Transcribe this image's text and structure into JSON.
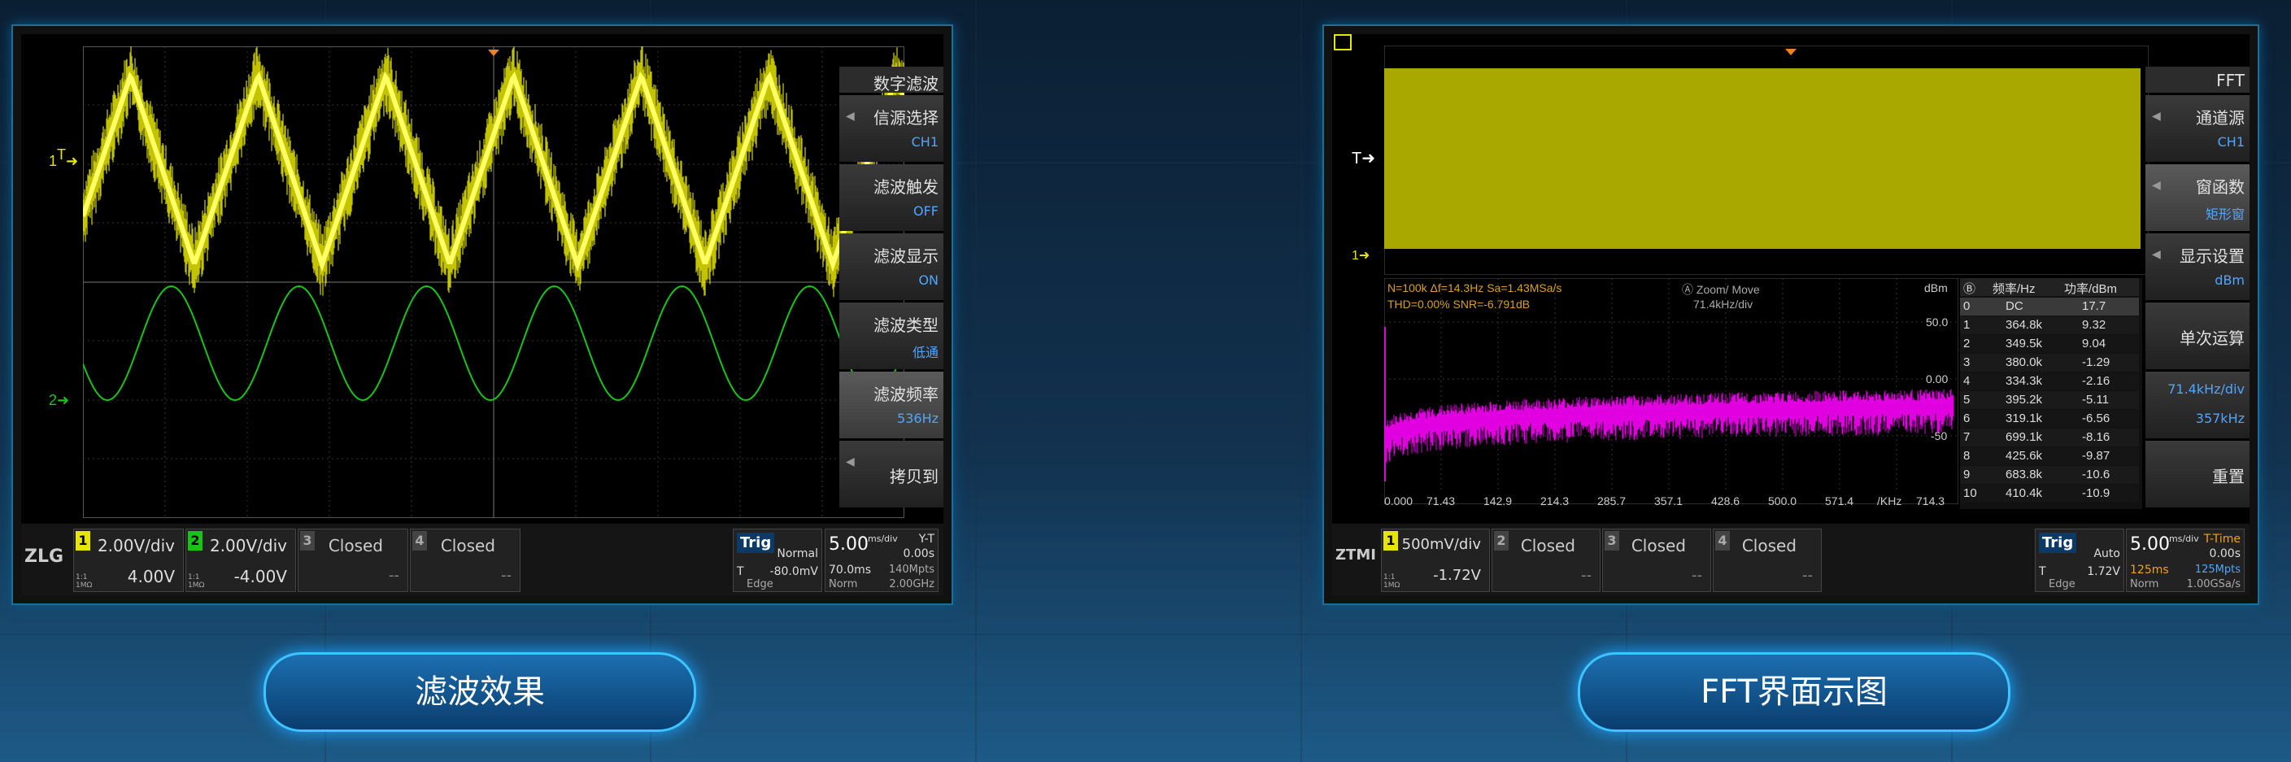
{
  "left_panel": {
    "menu": {
      "title": "数字滤波",
      "items": [
        {
          "label": "信源选择",
          "value": "CH1"
        },
        {
          "label": "滤波触发",
          "value": "OFF"
        },
        {
          "label": "滤波显示",
          "value": "ON"
        },
        {
          "label": "滤波类型",
          "value": "低通"
        },
        {
          "label": "滤波频率",
          "value": "536Hz"
        },
        {
          "label": "拷贝到",
          "value": ""
        }
      ]
    },
    "marker_1": "1",
    "marker_T": "T",
    "marker_2": "2",
    "status": {
      "logo": "ZLG",
      "ch1": {
        "num": "1",
        "scale": "2.00V/div",
        "offset": "4.00V",
        "imp": "1:1 1MΩ"
      },
      "ch2": {
        "num": "2",
        "scale": "2.00V/div",
        "offset": "-4.00V",
        "imp": "1:1 1MΩ"
      },
      "ch3": {
        "num": "3",
        "state": "Closed",
        "dash": "--"
      },
      "ch4": {
        "num": "4",
        "state": "Closed",
        "dash": "--"
      },
      "trig_label": "Trig",
      "trig_mode": "Normal",
      "trig_level": "-80.0mV",
      "trig_T": "T",
      "trig_type": "Edge",
      "time_scale": "5.00",
      "time_unit": "ms/div",
      "time_mode": "Y-T",
      "time_offset": "0.00s",
      "time_window": "70.0ms",
      "mem_depth": "140Mpts",
      "acq_mode": "Norm",
      "sample_rate": "2.00GHz"
    }
  },
  "right_panel": {
    "menu": {
      "title": "FFT",
      "items": [
        {
          "label": "通道源",
          "value": "CH1"
        },
        {
          "label": "窗函数",
          "value": "矩形窗"
        },
        {
          "label": "显示设置",
          "value": "dBm"
        },
        {
          "label": "单次运算",
          "value": ""
        },
        {
          "label": "71.4kHz/div",
          "value": "357kHz"
        },
        {
          "label": "重置",
          "value": ""
        }
      ]
    },
    "marker_T": "T",
    "marker_1": "1",
    "fft_info": {
      "line1": "N=100k  Δf=14.3Hz  Sa=1.43MSa/s",
      "line2": "THD=0.00%  SNR=-6.791dB",
      "zoom": "Zoom/ Move",
      "zoom_scale": "71.4kHz/div",
      "unit": "dBm",
      "y_ticks": [
        "50.0",
        "0.00",
        "-50"
      ],
      "x_ticks": [
        "0.000",
        "71.43",
        "142.9",
        "214.3",
        "285.7",
        "357.1",
        "428.6",
        "500.0",
        "571.4",
        "/KHz",
        "714.3"
      ]
    },
    "table": {
      "header": [
        "Ⓑ",
        "频率/Hz",
        "功率/dBm"
      ],
      "rows": [
        [
          "0",
          "DC",
          "17.7"
        ],
        [
          "1",
          "364.8k",
          "9.32"
        ],
        [
          "2",
          "349.5k",
          "9.04"
        ],
        [
          "3",
          "380.0k",
          "-1.29"
        ],
        [
          "4",
          "334.3k",
          "-2.16"
        ],
        [
          "5",
          "395.2k",
          "-5.11"
        ],
        [
          "6",
          "319.1k",
          "-6.56"
        ],
        [
          "7",
          "699.1k",
          "-8.16"
        ],
        [
          "8",
          "425.6k",
          "-9.87"
        ],
        [
          "9",
          "683.8k",
          "-10.6"
        ],
        [
          "10",
          "410.4k",
          "-10.9"
        ]
      ]
    },
    "status": {
      "logo": "ZTMI",
      "ch1": {
        "num": "1",
        "scale": "500mV/div",
        "offset": "-1.72V",
        "imp": "1:1 1MΩ"
      },
      "ch2": {
        "num": "2",
        "state": "Closed",
        "dash": "--"
      },
      "ch3": {
        "num": "3",
        "state": "Closed",
        "dash": "--"
      },
      "ch4": {
        "num": "4",
        "state": "Closed",
        "dash": "--"
      },
      "trig_label": "Trig",
      "trig_mode": "Auto",
      "trig_level": "1.72V",
      "trig_T": "T",
      "trig_type": "Edge",
      "time_scale": "5.00",
      "time_unit": "ms/div",
      "time_mode": "T-Time",
      "time_offset": "0.00s",
      "time_window": "125ms",
      "mem_depth": "125Mpts",
      "acq_mode": "Norm",
      "sample_rate": "1.00GSa/s"
    }
  },
  "buttons": {
    "left": "滤波效果",
    "right": "FFT界面示图"
  },
  "colors": {
    "ch1": "#e6e600",
    "ch2": "#19c419",
    "fft": "#e000e0",
    "accent": "#3ec4ff"
  }
}
